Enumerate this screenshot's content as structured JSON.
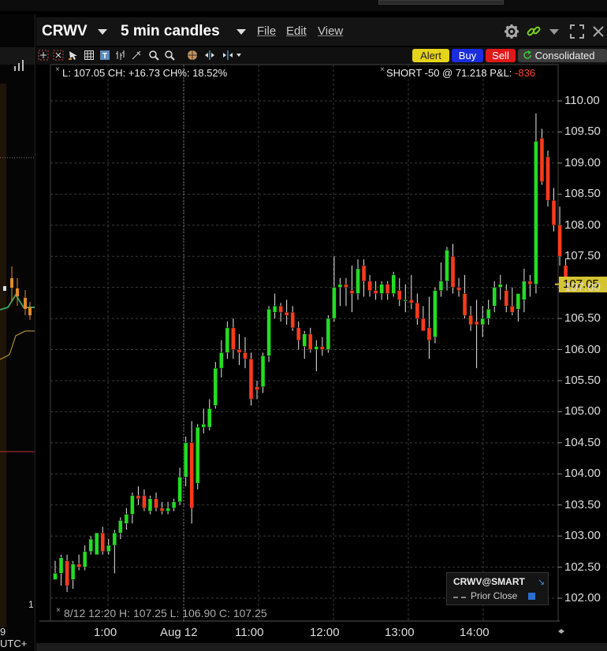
{
  "window": {
    "symbol": "CRWV",
    "interval": "5 min candles",
    "menus": [
      "File",
      "Edit",
      "View"
    ]
  },
  "toolbar": {
    "tools": [
      "crosshair-icon",
      "arrow-icon",
      "grid-icon",
      "text-icon",
      "bars-icon",
      "line-tool-icon",
      "zoom-in-icon",
      "zoom-out-icon",
      "target-icon",
      "split-icon",
      "fib-icon"
    ],
    "alert": "Alert",
    "buy": "Buy",
    "sell": "Sell",
    "consolidated": "Consolidated"
  },
  "info": {
    "ohlc_line": "L: 107.05 CH: +16.73 CH%: 18.52%",
    "position_prefix": "SHORT -50 @ 71.218 P&L: ",
    "position_pnl": "-836",
    "hover_line": "8/12 12:20  H: 107.25  L: 106.90  C: 107.25"
  },
  "legend": {
    "title": "CRWV@SMART",
    "prior_close": "Prior Close"
  },
  "left_panel": {
    "utc_label": "9 UTC+",
    "row_label": "1"
  },
  "colors": {
    "up": "#22dd22",
    "down": "#ff3a1a",
    "price_tag": "#d4c431",
    "background": "#000000",
    "grid": "#3a3a3a"
  },
  "chart_data": {
    "type": "candlestick",
    "last_price": "107.05",
    "y_ticks": [
      "110.00",
      "109.50",
      "109.00",
      "108.50",
      "108.00",
      "107.50",
      "107.00",
      "106.50",
      "106.00",
      "105.50",
      "105.00",
      "104.50",
      "104.00",
      "103.50",
      "103.00",
      "102.50",
      "102.00"
    ],
    "ylim": [
      101.95,
      110.2
    ],
    "x_ticks": [
      "1:00",
      "Aug 12",
      "11:00",
      "12:00",
      "13:00",
      "14:00"
    ],
    "candles": [
      [
        102.3,
        102.6,
        102.3,
        102.4
      ],
      [
        102.4,
        102.7,
        102.2,
        102.65
      ],
      [
        102.6,
        102.7,
        102.1,
        102.2
      ],
      [
        102.3,
        102.6,
        102.15,
        102.55
      ],
      [
        102.55,
        102.7,
        102.45,
        102.5
      ],
      [
        102.5,
        102.85,
        102.45,
        102.75
      ],
      [
        102.75,
        103.0,
        102.7,
        102.95
      ],
      [
        102.7,
        103.05,
        102.7,
        103.05
      ],
      [
        103.05,
        103.15,
        102.7,
        102.75
      ],
      [
        102.75,
        102.95,
        102.7,
        102.85
      ],
      [
        102.85,
        103.1,
        102.4,
        103.05
      ],
      [
        103.05,
        103.3,
        102.95,
        103.25
      ],
      [
        103.2,
        103.45,
        103.1,
        103.35
      ],
      [
        103.35,
        103.7,
        103.2,
        103.65
      ],
      [
        103.65,
        103.8,
        103.5,
        103.6
      ],
      [
        103.65,
        103.75,
        103.4,
        103.45
      ],
      [
        103.4,
        103.65,
        103.35,
        103.6
      ],
      [
        103.6,
        103.7,
        103.4,
        103.45
      ],
      [
        103.45,
        103.55,
        103.35,
        103.4
      ],
      [
        103.4,
        103.55,
        103.35,
        103.45
      ],
      [
        103.45,
        103.6,
        103.4,
        103.55
      ],
      [
        103.55,
        104.1,
        103.5,
        103.95
      ],
      [
        103.95,
        104.6,
        103.8,
        104.5
      ],
      [
        104.5,
        104.85,
        103.2,
        103.45
      ],
      [
        103.85,
        104.8,
        103.75,
        104.75
      ],
      [
        104.75,
        105.05,
        104.65,
        104.8
      ],
      [
        104.75,
        105.2,
        104.7,
        105.05
      ],
      [
        105.1,
        105.8,
        105.05,
        105.7
      ],
      [
        105.7,
        106.15,
        105.55,
        105.95
      ],
      [
        105.95,
        106.45,
        105.85,
        106.35
      ],
      [
        106.35,
        106.5,
        105.85,
        106.0
      ],
      [
        106.0,
        106.25,
        105.75,
        105.95
      ],
      [
        105.95,
        106.2,
        105.7,
        105.85
      ],
      [
        105.85,
        105.95,
        105.1,
        105.2
      ],
      [
        105.4,
        105.5,
        105.2,
        105.35
      ],
      [
        105.4,
        105.95,
        105.3,
        105.9
      ],
      [
        105.9,
        106.7,
        105.8,
        106.65
      ],
      [
        106.6,
        106.9,
        106.5,
        106.7
      ],
      [
        106.7,
        106.75,
        106.45,
        106.6
      ],
      [
        106.6,
        106.8,
        106.4,
        106.55
      ],
      [
        106.6,
        106.7,
        106.3,
        106.35
      ],
      [
        106.35,
        106.45,
        106.0,
        106.15
      ],
      [
        106.05,
        106.3,
        105.85,
        106.25
      ],
      [
        106.25,
        106.35,
        105.95,
        106.0
      ],
      [
        106.0,
        106.15,
        105.65,
        106.05
      ],
      [
        106.05,
        106.2,
        105.9,
        106.0
      ],
      [
        106.0,
        106.55,
        105.95,
        106.5
      ],
      [
        106.5,
        107.5,
        106.45,
        107.0
      ],
      [
        107.0,
        107.15,
        106.7,
        107.05
      ],
      [
        107.05,
        107.15,
        106.7,
        107.0
      ],
      [
        106.95,
        107.35,
        106.6,
        106.9
      ],
      [
        106.9,
        107.45,
        106.8,
        107.3
      ],
      [
        107.35,
        107.45,
        106.85,
        107.1
      ],
      [
        107.1,
        107.2,
        106.85,
        106.95
      ],
      [
        106.95,
        107.1,
        106.8,
        106.9
      ],
      [
        106.9,
        107.1,
        106.8,
        107.05
      ],
      [
        107.05,
        107.1,
        106.8,
        106.9
      ],
      [
        106.9,
        107.25,
        106.85,
        107.2
      ],
      [
        106.95,
        107.15,
        106.7,
        106.8
      ],
      [
        106.8,
        107.05,
        106.6,
        106.8
      ],
      [
        106.8,
        107.2,
        106.65,
        106.75
      ],
      [
        106.75,
        106.9,
        106.4,
        106.5
      ],
      [
        106.5,
        106.7,
        106.3,
        106.3
      ],
      [
        106.35,
        106.85,
        105.85,
        106.15
      ],
      [
        106.2,
        107.0,
        106.1,
        106.95
      ],
      [
        106.95,
        107.4,
        106.85,
        107.1
      ],
      [
        107.1,
        107.65,
        106.95,
        107.6
      ],
      [
        107.5,
        107.7,
        106.9,
        107.0
      ],
      [
        107.0,
        107.15,
        106.85,
        106.95
      ],
      [
        106.9,
        107.2,
        106.5,
        106.55
      ],
      [
        106.55,
        106.7,
        106.3,
        106.4
      ],
      [
        106.45,
        106.8,
        105.7,
        106.4
      ],
      [
        106.4,
        106.7,
        106.2,
        106.5
      ],
      [
        106.5,
        106.8,
        106.4,
        106.65
      ],
      [
        106.7,
        107.1,
        106.6,
        107.0
      ],
      [
        107.0,
        107.2,
        106.8,
        107.05
      ],
      [
        106.95,
        107.05,
        106.6,
        106.7
      ],
      [
        106.7,
        107.0,
        106.55,
        106.6
      ],
      [
        106.65,
        106.9,
        106.45,
        106.9
      ],
      [
        106.8,
        107.3,
        106.6,
        107.1
      ],
      [
        107.1,
        107.2,
        106.85,
        107.05
      ],
      [
        107.05,
        109.8,
        106.9,
        109.35
      ],
      [
        109.4,
        109.55,
        108.65,
        108.7
      ],
      [
        109.1,
        109.2,
        108.3,
        108.4
      ],
      [
        108.4,
        108.6,
        107.9,
        108.0
      ],
      [
        108.0,
        108.3,
        107.35,
        107.5
      ],
      [
        107.35,
        107.45,
        107.05,
        107.05
      ]
    ]
  }
}
